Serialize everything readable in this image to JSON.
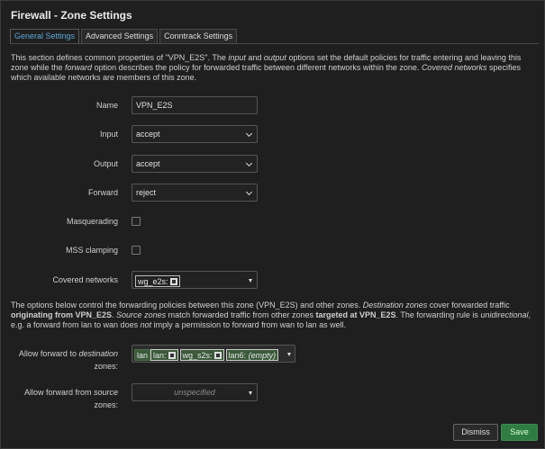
{
  "title": "Firewall - Zone Settings",
  "tabs": [
    {
      "label": "General Settings",
      "active": true
    },
    {
      "label": "Advanced Settings",
      "active": false
    },
    {
      "label": "Conntrack Settings",
      "active": false
    }
  ],
  "intro": {
    "p1": "This section defines common properties of \"VPN_E2S\". The ",
    "input_word": "input",
    "p2": " and ",
    "output_word": "output",
    "p3": " options set the default policies for traffic entering and leaving this zone while the ",
    "forward_word": "forward",
    "p4": " option describes the policy for forwarded traffic between different networks within the zone. ",
    "covered_word": "Covered networks",
    "p5": " specifies which available networks are members of this zone."
  },
  "fields": {
    "name": {
      "label": "Name",
      "value": "VPN_E2S"
    },
    "input": {
      "label": "Input",
      "value": "accept"
    },
    "output": {
      "label": "Output",
      "value": "accept"
    },
    "forward": {
      "label": "Forward",
      "value": "reject"
    },
    "masquerading": {
      "label": "Masquerading",
      "checked": false
    },
    "mss": {
      "label": "MSS clamping",
      "checked": false
    },
    "covered": {
      "label": "Covered networks",
      "chip": "wg_e2s:"
    }
  },
  "forwarding_desc": {
    "p1": "The options below control the forwarding policies between this zone (VPN_E2S) and other zones. ",
    "dest_word": "Destination zones",
    "p2": " cover forwarded traffic ",
    "orig_bold": "originating from VPN_E2S",
    "p3": ". ",
    "src_word": "Source zones",
    "p4": " match forwarded traffic from other zones ",
    "target_bold": "targeted at VPN_E2S",
    "p5": ". The forwarding rule is ",
    "uni_word": "unidirectional",
    "p6": ", e.g. a forward from lan to wan does ",
    "not_word": "not",
    "p7": " imply a permission to forward from wan to lan as well."
  },
  "allow_dest": {
    "label_a": "Allow forward to ",
    "label_em": "destination",
    "label_b": "zones:",
    "chips": [
      "lan",
      "lan:",
      "wg_s2s:",
      "lan6:",
      "(empty)"
    ]
  },
  "allow_src": {
    "label_a": "Allow forward from ",
    "label_em": "source",
    "label_b": "zones:",
    "placeholder": "unspecified"
  },
  "buttons": {
    "dismiss": "Dismiss",
    "save": "Save"
  },
  "colors": {
    "accent": "#5ba8d6",
    "zone_green": "#3a5a3a",
    "save_green": "#2f7d41"
  }
}
